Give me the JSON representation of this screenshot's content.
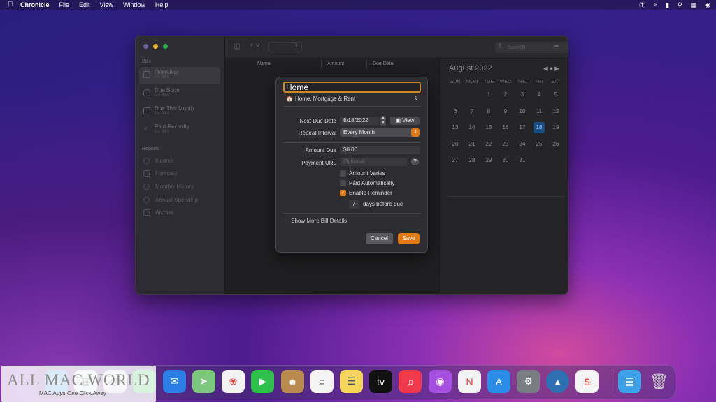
{
  "menubar": {
    "app": "Chronicle",
    "items": [
      "File",
      "Edit",
      "View",
      "Window",
      "Help"
    ]
  },
  "sidebar": {
    "section_bills": "Bills",
    "items": [
      {
        "label": "Overview",
        "sub": "No Bills"
      },
      {
        "label": "Due Soon",
        "sub": "No Bills"
      },
      {
        "label": "Due This Month",
        "sub": "No Bills"
      },
      {
        "label": "Paid Recently",
        "sub": "No Bills"
      }
    ],
    "section_reports": "Reports",
    "reports": [
      "Income",
      "Forecast",
      "Monthly History",
      "Annual Spending",
      "Archive"
    ]
  },
  "toolbar": {
    "search_placeholder": "Search"
  },
  "columns": [
    "Name",
    "Amount",
    "Due Date"
  ],
  "calendar": {
    "title": "August 2022",
    "dow": [
      "SUN",
      "MON",
      "TUE",
      "WED",
      "THU",
      "FRI",
      "SAT"
    ],
    "days": [
      "",
      "",
      "1",
      "2",
      "3",
      "4",
      "5",
      "6",
      "7",
      "8",
      "9",
      "10",
      "11",
      "12",
      "13",
      "14",
      "15",
      "16",
      "17",
      "18",
      "19",
      "20",
      "21",
      "22",
      "23",
      "24",
      "25",
      "26",
      "27",
      "28",
      "29",
      "30",
      "31",
      "",
      "",
      ""
    ],
    "today": "18"
  },
  "dialog": {
    "title": "Home",
    "category": "Home, Mortgage & Rent",
    "next_due_label": "Next Due Date",
    "next_due_value": "8/18/2022",
    "view_button": "View",
    "repeat_label": "Repeat Interval",
    "repeat_value": "Every Month",
    "amount_label": "Amount Due",
    "amount_value": "$0.00",
    "url_label": "Payment URL",
    "url_placeholder": "Optional",
    "amount_varies": "Amount Varies",
    "paid_auto": "Paid Automatically",
    "enable_reminder": "Enable Reminder",
    "days_value": "7",
    "days_label": "days before due",
    "more": "Show More Bill Details",
    "cancel": "Cancel",
    "save": "Save"
  },
  "watermark": {
    "title": "ALL MAC WORLD",
    "subtitle": "MAC Apps One Click Away"
  },
  "colors": {
    "accent": "#e07a15",
    "today": "#1b4f83"
  }
}
